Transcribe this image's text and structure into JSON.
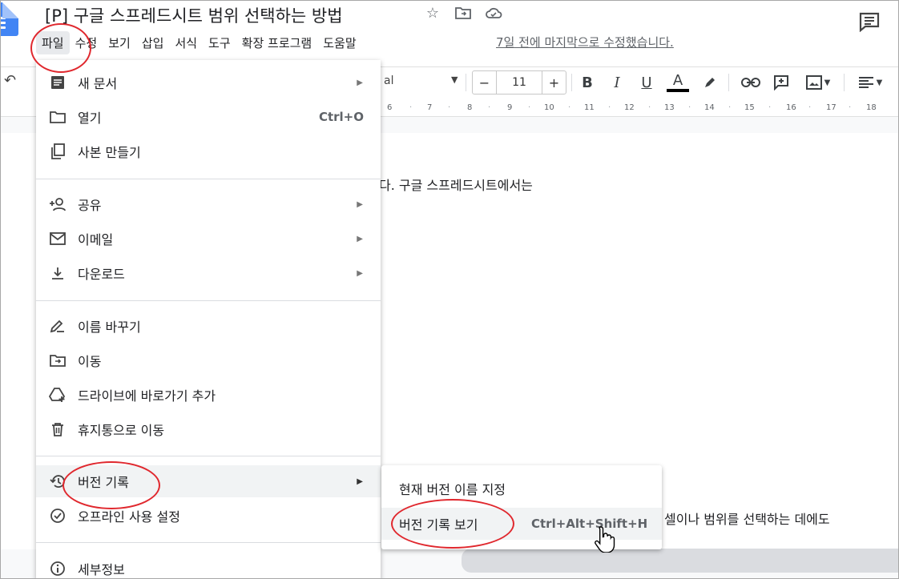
{
  "document": {
    "title": "[P] 구글 스프레드시트 범위 선택하는 방법",
    "last_edit": "7일 전에 마지막으로 수정했습니다.",
    "body_line1": "다. 구글 스프레드시트에서는",
    "body_line2": "셀이나 범위를 선택하는 데에도"
  },
  "menubar": {
    "items": [
      {
        "label": "파일"
      },
      {
        "label": "수정"
      },
      {
        "label": "보기"
      },
      {
        "label": "삽입"
      },
      {
        "label": "서식"
      },
      {
        "label": "도구"
      },
      {
        "label": "확장 프로그램"
      },
      {
        "label": "도움말"
      }
    ]
  },
  "toolbar": {
    "font_name": "al",
    "font_size": "11",
    "minus": "−",
    "plus": "+",
    "bold": "B",
    "italic": "I",
    "underline": "U",
    "text_color": "A"
  },
  "ruler": {
    "ticks": [
      "6",
      "7",
      "8",
      "9",
      "10",
      "11",
      "12",
      "13",
      "14",
      "15",
      "16",
      "17",
      "18"
    ]
  },
  "file_menu": {
    "items": [
      {
        "label": "새 문서",
        "icon": "doc-icon",
        "submenu": true
      },
      {
        "label": "열기",
        "icon": "folder-icon",
        "shortcut": "Ctrl+O"
      },
      {
        "label": "사본 만들기",
        "icon": "copy-icon"
      },
      {
        "label": "공유",
        "icon": "add-person-icon",
        "submenu": true
      },
      {
        "label": "이메일",
        "icon": "mail-icon",
        "submenu": true
      },
      {
        "label": "다운로드",
        "icon": "download-icon",
        "submenu": true
      },
      {
        "label": "이름 바꾸기",
        "icon": "rename-icon"
      },
      {
        "label": "이동",
        "icon": "move-folder-icon"
      },
      {
        "label": "드라이브에 바로가기 추가",
        "icon": "drive-shortcut-icon"
      },
      {
        "label": "휴지통으로 이동",
        "icon": "trash-icon"
      },
      {
        "label": "버전 기록",
        "icon": "history-icon",
        "submenu": true
      },
      {
        "label": "오프라인 사용 설정",
        "icon": "offline-icon"
      },
      {
        "label": "세부정보",
        "icon": "info-icon"
      }
    ]
  },
  "version_submenu": {
    "items": [
      {
        "label": "현재 버전 이름 지정"
      },
      {
        "label": "버전 기록 보기",
        "shortcut": "Ctrl+Alt+Shift+H"
      }
    ]
  },
  "colors": {
    "accent_blue": "#4285f4",
    "annotation_red": "#e0282e",
    "menu_highlight": "#f1f3f4"
  }
}
